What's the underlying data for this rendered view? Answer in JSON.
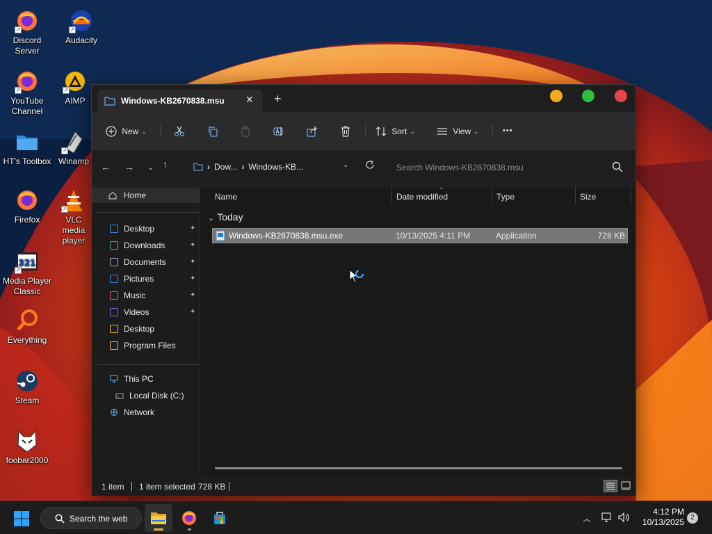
{
  "desktop": {
    "icons": [
      {
        "label": "Discord Server",
        "icon": "firefox-shortcut-icon"
      },
      {
        "label": "Audacity",
        "icon": "audacity-icon"
      },
      {
        "label": "YouTube Channel",
        "icon": "firefox-shortcut-icon"
      },
      {
        "label": "AIMP",
        "icon": "aimp-icon"
      },
      {
        "label": "HT's Toolbox",
        "icon": "folder-icon"
      },
      {
        "label": "Winamp",
        "icon": "winamp-icon"
      },
      {
        "label": "Firefox",
        "icon": "firefox-icon"
      },
      {
        "label": "VLC media player",
        "icon": "vlc-icon"
      },
      {
        "label": "Media Player Classic",
        "icon": "mpc-icon"
      },
      {
        "label": "Everything",
        "icon": "everything-icon"
      },
      {
        "label": "Steam",
        "icon": "steam-icon"
      },
      {
        "label": "foobar2000",
        "icon": "foobar-icon"
      }
    ]
  },
  "explorer": {
    "tab_title": "Windows-KB2670838.msu",
    "tab_close": "✕",
    "new_tab": "+",
    "toolbar": {
      "new_label": "New",
      "sort_label": "Sort",
      "view_label": "View",
      "more": "•••"
    },
    "address": {
      "crumbs": [
        "Dow...",
        "Windows-KB..."
      ],
      "search_placeholder": "Search Windows-KB2670838.msu"
    },
    "nav": {
      "home": "Home",
      "quick_access": [
        {
          "label": "Desktop",
          "pinned": true,
          "icon": "desktop-icon",
          "color": "#3b8fe0"
        },
        {
          "label": "Downloads",
          "pinned": true,
          "icon": "download-icon",
          "color": "#3fb36b"
        },
        {
          "label": "Documents",
          "pinned": true,
          "icon": "document-icon",
          "color": "#8fa6c8"
        },
        {
          "label": "Pictures",
          "pinned": true,
          "icon": "pictures-icon",
          "color": "#3b8fe0"
        },
        {
          "label": "Music",
          "pinned": true,
          "icon": "music-icon",
          "color": "#e0547a"
        },
        {
          "label": "Videos",
          "pinned": true,
          "icon": "videos-icon",
          "color": "#9b59d0"
        },
        {
          "label": "Desktop",
          "pinned": false,
          "icon": "folder-icon",
          "color": "#e8b84a"
        },
        {
          "label": "Program Files",
          "pinned": false,
          "icon": "folder-icon",
          "color": "#e8b84a"
        }
      ],
      "this_pc": "This PC",
      "local_disk": "Local Disk (C:)",
      "network": "Network",
      "pin_glyph": "📌"
    },
    "columns": {
      "name": "Name",
      "date": "Date modified",
      "type": "Type",
      "size": "Size"
    },
    "group": "Today",
    "files": [
      {
        "name": "Windows-KB2670838.msu.exe",
        "date": "10/13/2025 4:11 PM",
        "type": "Application",
        "size": "728 KB",
        "selected": true
      }
    ],
    "status": {
      "items": "1 item",
      "selected": "1 item selected",
      "size": "728 KB"
    }
  },
  "taskbar": {
    "search_label": "Search the web",
    "time": "4:12 PM",
    "date": "10/13/2025",
    "notifications": "2"
  },
  "colors": {
    "accent": "#0078d4",
    "selection": "#777777",
    "window_bg": "#191919"
  }
}
